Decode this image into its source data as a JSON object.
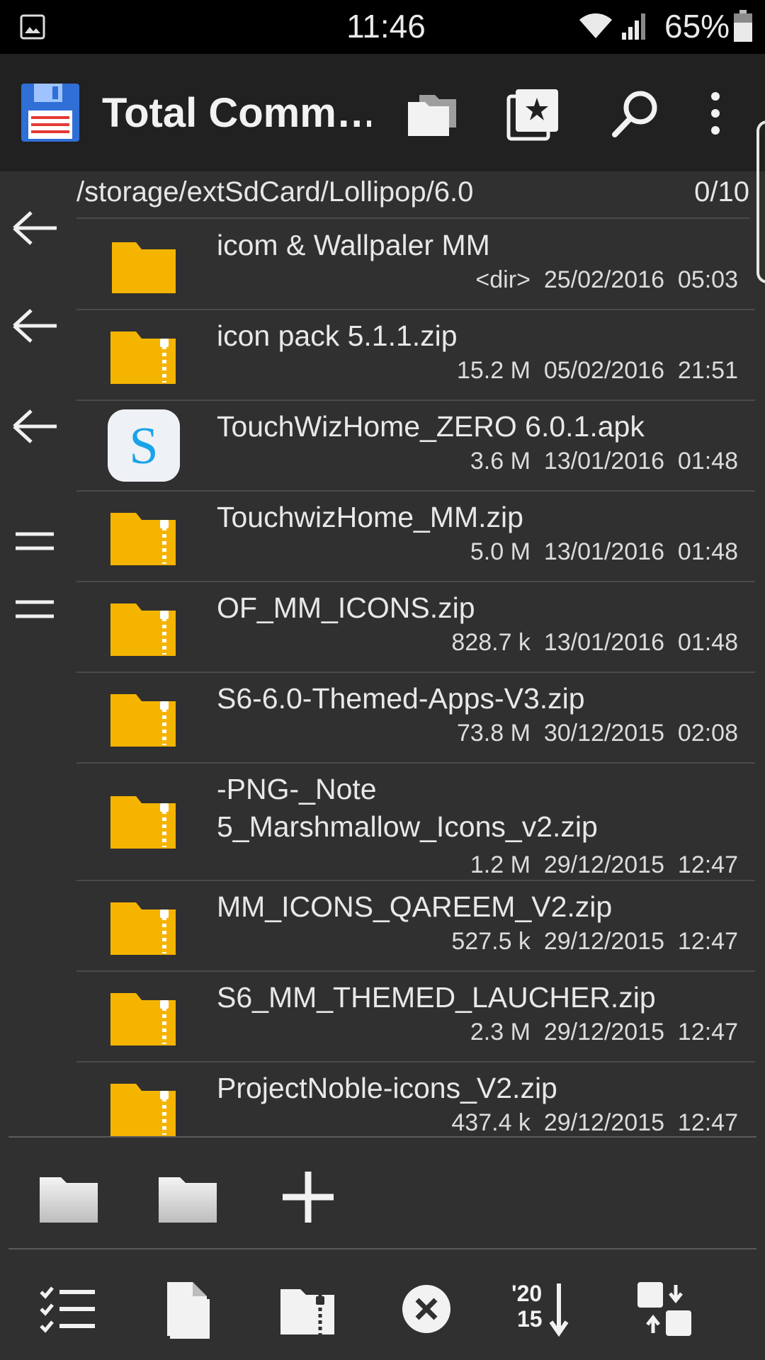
{
  "status_bar": {
    "time": "11:46",
    "battery_percent": "65%",
    "icons": [
      "gallery-icon",
      "wifi-icon",
      "signal-icon",
      "battery-icon"
    ]
  },
  "app_bar": {
    "title": "Total Comm…",
    "actions": [
      "folders-icon",
      "bookmark-star-icon",
      "search-icon",
      "more-vert-icon"
    ]
  },
  "path_bar": {
    "path": "/storage/extSdCard/Lollipop/6.0",
    "selection_count": "0/10"
  },
  "files": [
    {
      "name": "icom & Wallpaler MM",
      "size": "<dir>",
      "date": "25/02/2016",
      "time": "05:03",
      "icon": "folder-icon"
    },
    {
      "name": "icon pack 5.1.1.zip",
      "size": "15.2 M",
      "date": "05/02/2016",
      "time": "21:51",
      "icon": "zip-folder-icon"
    },
    {
      "name": "TouchWizHome_ZERO 6.0.1.apk",
      "size": "3.6 M",
      "date": "13/01/2016",
      "time": "01:48",
      "icon": "apk-s-icon"
    },
    {
      "name": "TouchwizHome_MM.zip",
      "size": "5.0 M",
      "date": "13/01/2016",
      "time": "01:48",
      "icon": "zip-folder-icon"
    },
    {
      "name": "OF_MM_ICONS.zip",
      "size": "828.7 k",
      "date": "13/01/2016",
      "time": "01:48",
      "icon": "zip-folder-icon"
    },
    {
      "name": "S6-6.0-Themed-Apps-V3.zip",
      "size": "73.8 M",
      "date": "30/12/2015",
      "time": "02:08",
      "icon": "zip-folder-icon"
    },
    {
      "name": "-PNG-_Note 5_Marshmallow_Icons_v2.zip",
      "size": "1.2 M",
      "date": "29/12/2015",
      "time": "12:47",
      "icon": "zip-folder-icon"
    },
    {
      "name": "MM_ICONS_QAREEM_V2.zip",
      "size": "527.5 k",
      "date": "29/12/2015",
      "time": "12:47",
      "icon": "zip-folder-icon"
    },
    {
      "name": "S6_MM_THEMED_LAUCHER.zip",
      "size": "2.3 M",
      "date": "29/12/2015",
      "time": "12:47",
      "icon": "zip-folder-icon"
    },
    {
      "name": "ProjectNoble-icons_V2.zip",
      "size": "437.4 k",
      "date": "29/12/2015",
      "time": "12:47",
      "icon": "zip-folder-icon"
    }
  ],
  "quick_bar": [
    "folder-shortcut-icon",
    "folder-shortcut-icon",
    "add-icon"
  ],
  "bottom_toolbar": {
    "buttons": [
      "select-list-icon",
      "new-file-icon",
      "zip-pack-icon",
      "delete-circle-icon",
      "sort-date-icon",
      "swap-panels-icon"
    ],
    "sort_label_top": "'20",
    "sort_label_bottom": "15"
  },
  "colors": {
    "background": "#303030",
    "app_bar": "#212121",
    "folder": "#F5B400",
    "divider": "#4a4a4a"
  }
}
